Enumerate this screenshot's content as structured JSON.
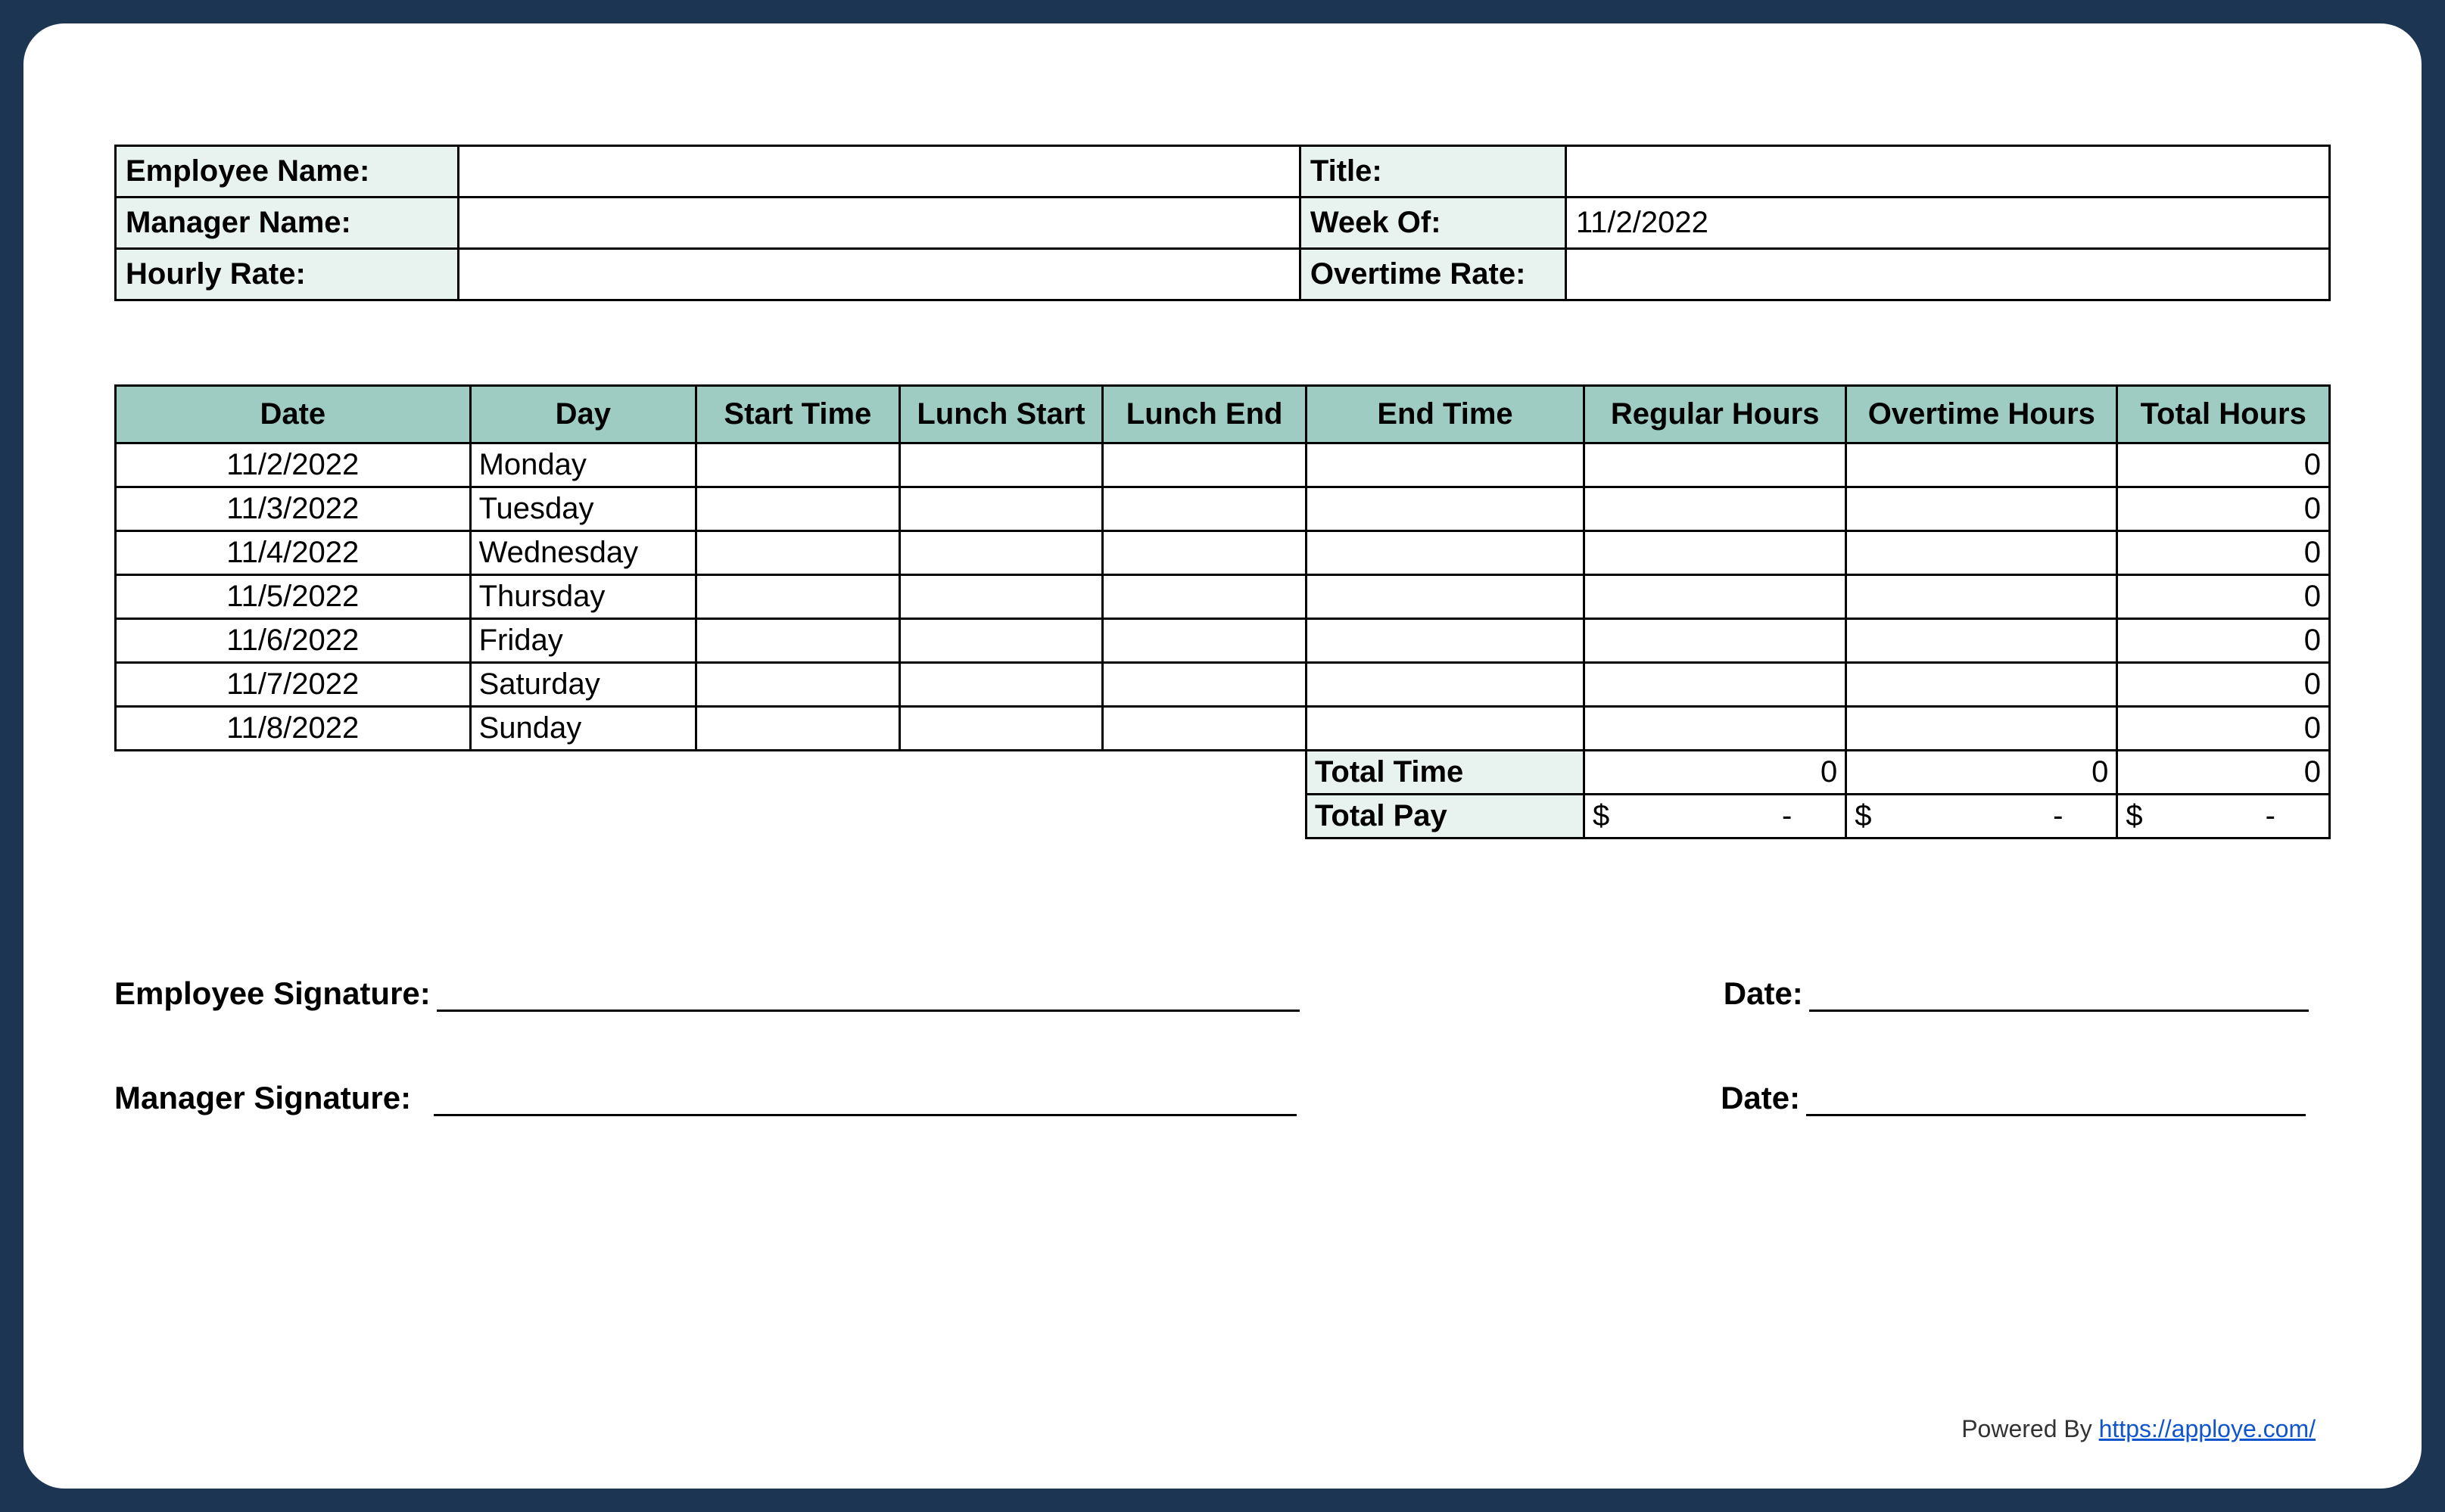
{
  "info": {
    "employee_name_label": "Employee Name:",
    "employee_name_value": "",
    "title_label": "Title:",
    "title_value": "",
    "manager_name_label": "Manager Name:",
    "manager_name_value": "",
    "week_of_label": "Week Of:",
    "week_of_value": "11/2/2022",
    "hourly_rate_label": "Hourly Rate:",
    "hourly_rate_value": "",
    "overtime_rate_label": "Overtime Rate:",
    "overtime_rate_value": ""
  },
  "columns": {
    "date": "Date",
    "day": "Day",
    "start": "Start Time",
    "lunch_start": "Lunch Start",
    "lunch_end": "Lunch End",
    "end": "End Time",
    "regular": "Regular Hours",
    "overtime": "Overtime Hours",
    "total": "Total Hours"
  },
  "rows": [
    {
      "date": "11/2/2022",
      "day": "Monday",
      "start": "",
      "lunch_start": "",
      "lunch_end": "",
      "end": "",
      "regular": "",
      "overtime": "",
      "total": "0"
    },
    {
      "date": "11/3/2022",
      "day": "Tuesday",
      "start": "",
      "lunch_start": "",
      "lunch_end": "",
      "end": "",
      "regular": "",
      "overtime": "",
      "total": "0"
    },
    {
      "date": "11/4/2022",
      "day": "Wednesday",
      "start": "",
      "lunch_start": "",
      "lunch_end": "",
      "end": "",
      "regular": "",
      "overtime": "",
      "total": "0"
    },
    {
      "date": "11/5/2022",
      "day": "Thursday",
      "start": "",
      "lunch_start": "",
      "lunch_end": "",
      "end": "",
      "regular": "",
      "overtime": "",
      "total": "0"
    },
    {
      "date": "11/6/2022",
      "day": "Friday",
      "start": "",
      "lunch_start": "",
      "lunch_end": "",
      "end": "",
      "regular": "",
      "overtime": "",
      "total": "0"
    },
    {
      "date": "11/7/2022",
      "day": "Saturday",
      "start": "",
      "lunch_start": "",
      "lunch_end": "",
      "end": "",
      "regular": "",
      "overtime": "",
      "total": "0"
    },
    {
      "date": "11/8/2022",
      "day": "Sunday",
      "start": "",
      "lunch_start": "",
      "lunch_end": "",
      "end": "",
      "regular": "",
      "overtime": "",
      "total": "0"
    }
  ],
  "totals": {
    "time_label": "Total Time",
    "time_regular": "0",
    "time_overtime": "0",
    "time_total": "0",
    "pay_label": "Total Pay",
    "pay_regular_sym": "$",
    "pay_regular_val": "-",
    "pay_overtime_sym": "$",
    "pay_overtime_val": "-",
    "pay_total_sym": "$",
    "pay_total_val": "-"
  },
  "signatures": {
    "employee_label": "Employee Signature:",
    "manager_label": "Manager Signature:",
    "date_label": "Date:"
  },
  "footer": {
    "powered_by": "Powered By ",
    "link_text": "https://apploye.com/"
  }
}
